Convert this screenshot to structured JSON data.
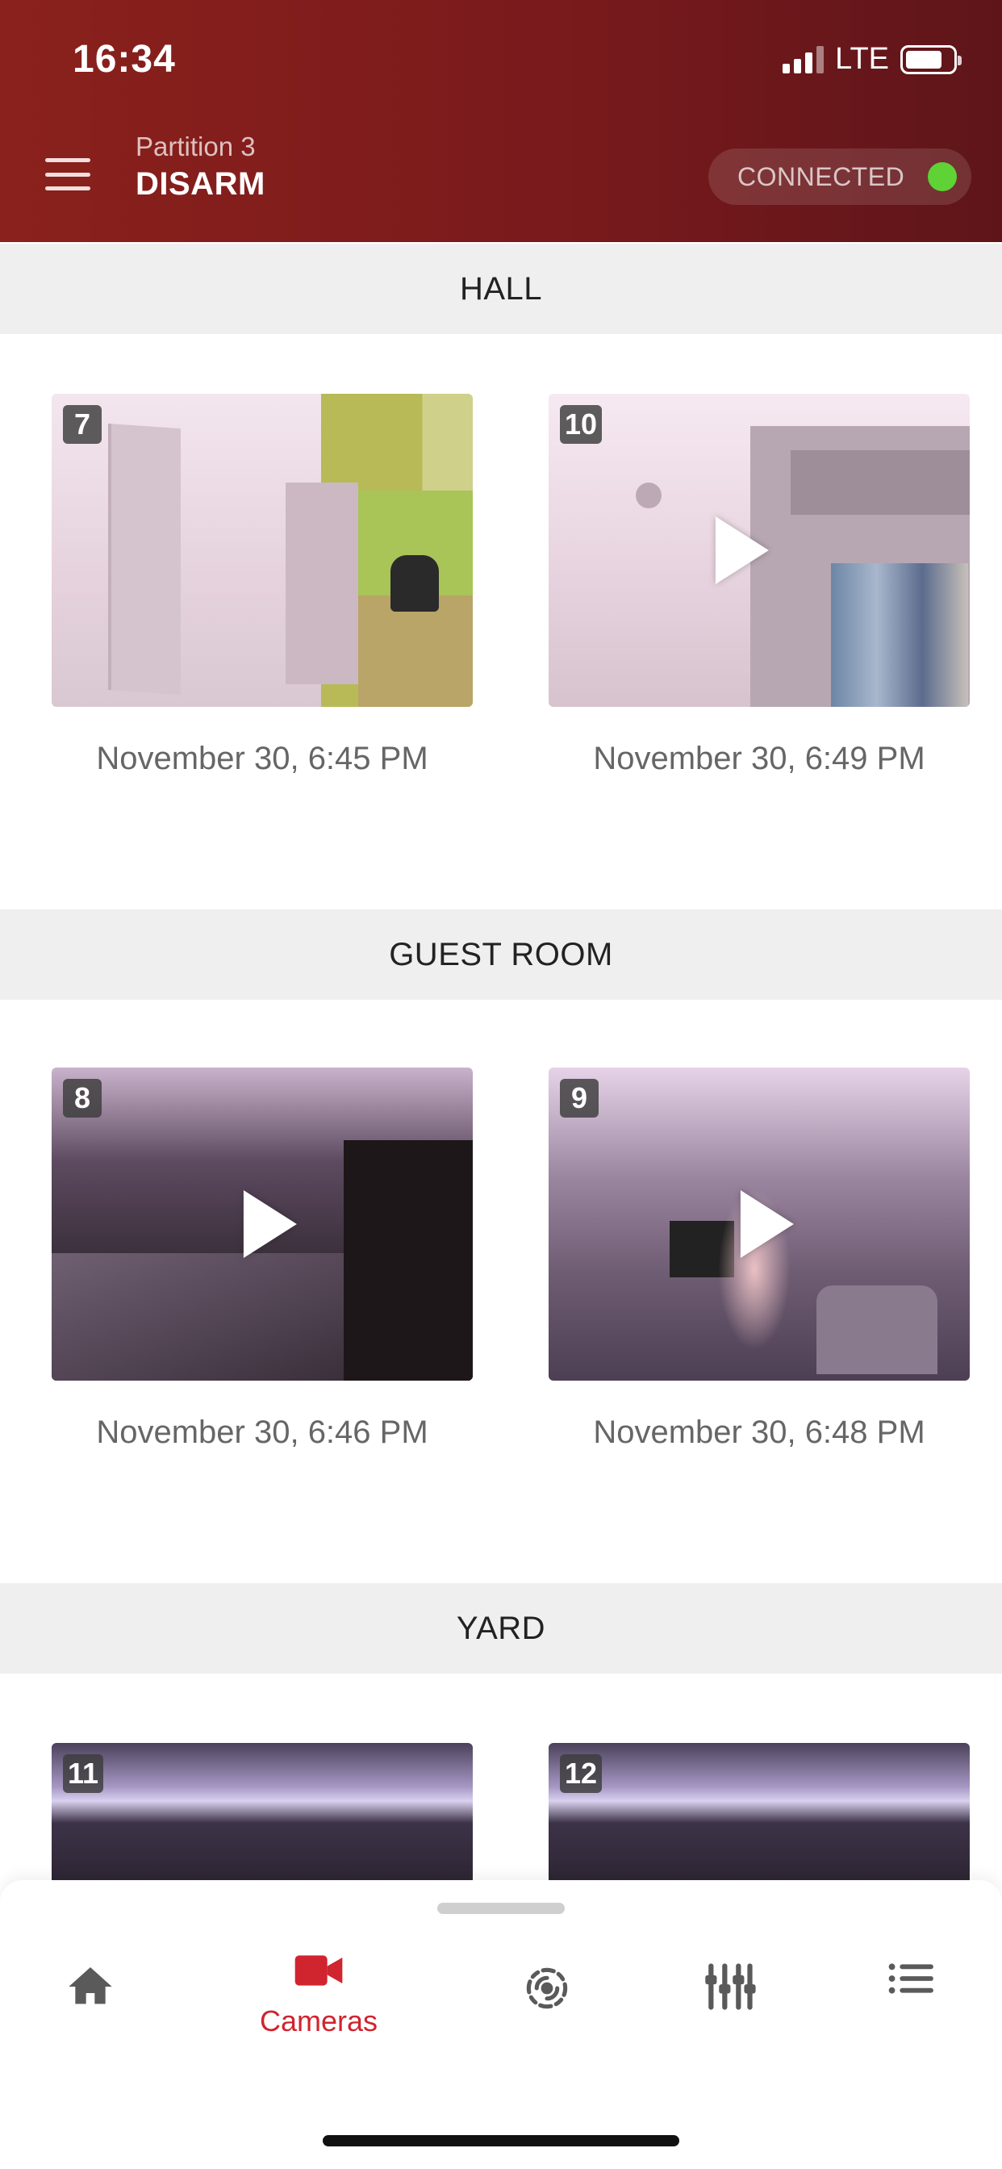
{
  "status_bar": {
    "time": "16:34",
    "network": "LTE"
  },
  "header": {
    "partition": "Partition 3",
    "arm_state": "DISARM",
    "connection_status": "CONNECTED",
    "connection_color": "#5fd236"
  },
  "sections": [
    {
      "title": "HALL",
      "cameras": [
        {
          "number": "7",
          "timestamp": "November 30, 6:45 PM",
          "has_play": false
        },
        {
          "number": "10",
          "timestamp": "November 30, 6:49 PM",
          "has_play": true
        }
      ]
    },
    {
      "title": "GUEST ROOM",
      "cameras": [
        {
          "number": "8",
          "timestamp": "November 30, 6:46 PM",
          "has_play": true
        },
        {
          "number": "9",
          "timestamp": "November 30, 6:48 PM",
          "has_play": true
        }
      ]
    },
    {
      "title": "YARD",
      "cameras": [
        {
          "number": "11"
        },
        {
          "number": "12"
        }
      ]
    }
  ],
  "tabbar": {
    "active_color": "#d0242f",
    "inactive_color": "#5a5a5a",
    "tabs": [
      {
        "icon": "home-icon",
        "label": "",
        "active": false
      },
      {
        "icon": "video-camera-icon",
        "label": "Cameras",
        "active": true
      },
      {
        "icon": "devices-radar-icon",
        "label": "",
        "active": false
      },
      {
        "icon": "sliders-icon",
        "label": "",
        "active": false
      },
      {
        "icon": "list-icon",
        "label": "",
        "active": false
      }
    ]
  }
}
